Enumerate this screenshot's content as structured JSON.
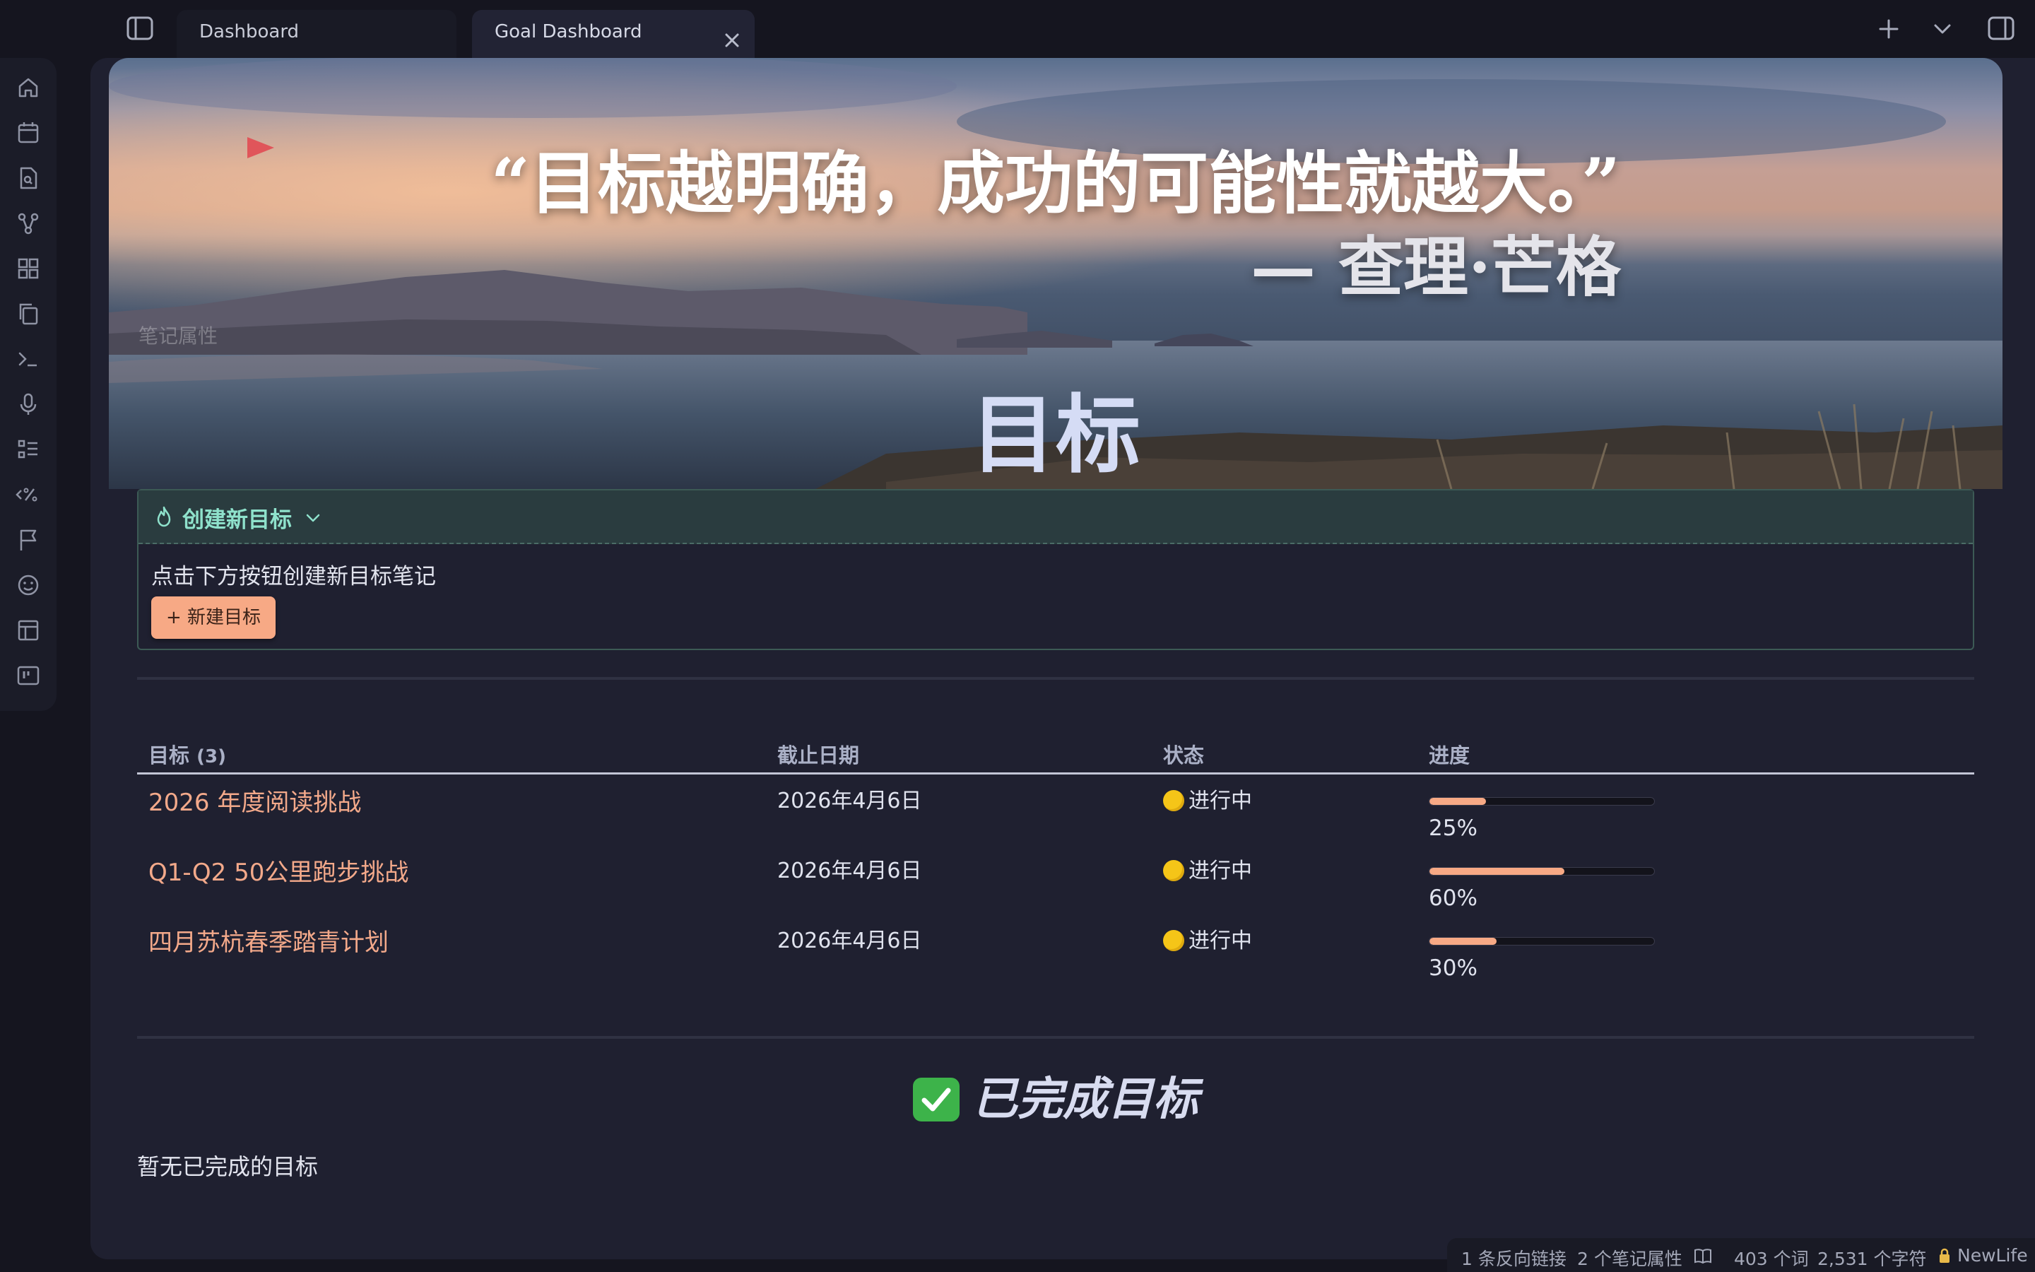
{
  "tabs": [
    {
      "label": "Dashboard",
      "active": false
    },
    {
      "label": "Goal Dashboard",
      "active": true
    }
  ],
  "ribbon_icons": [
    "home-icon",
    "calendar-icon",
    "file-search-icon",
    "graph-icon",
    "grid-icon",
    "copy-icon",
    "terminal-icon",
    "microphone-icon",
    "list-icon",
    "percent-icon",
    "flag-icon",
    "smile-icon",
    "layout-icon",
    "kanban-icon"
  ],
  "banner": {
    "quote": "“目标越明确，成功的可能性就越大。”",
    "author": "— 查理·芒格",
    "props_label": "笔记属性"
  },
  "page_title": "目标",
  "callout": {
    "title": "创建新目标",
    "text": "点击下方按钮创建新目标笔记",
    "button": "+ 新建目标"
  },
  "table": {
    "headers": {
      "goal": "目标",
      "goal_count": "(3)",
      "deadline": "截止日期",
      "status": "状态",
      "progress": "进度"
    },
    "rows": [
      {
        "goal": "2026 年度阅读挑战",
        "deadline": "2026年4月6日",
        "status": "进行中",
        "progress": 25,
        "progress_label": "25%"
      },
      {
        "goal": "Q1-Q2 50公里跑步挑战",
        "deadline": "2026年4月6日",
        "status": "进行中",
        "progress": 60,
        "progress_label": "60%"
      },
      {
        "goal": "四月苏杭春季踏青计划",
        "deadline": "2026年4月6日",
        "status": "进行中",
        "progress": 30,
        "progress_label": "30%"
      }
    ]
  },
  "completed": {
    "title": "已完成目标",
    "empty_text": "暂无已完成的目标"
  },
  "statusbar": {
    "backlinks": "1 条反向链接",
    "properties": "2 个笔记属性",
    "words": "403 个词",
    "chars": "2,531 个字符",
    "vault": "NewLife"
  },
  "colors": {
    "accent": "#f7a985",
    "callout": "#8fe2cc",
    "status_dot": "#f5c518"
  }
}
